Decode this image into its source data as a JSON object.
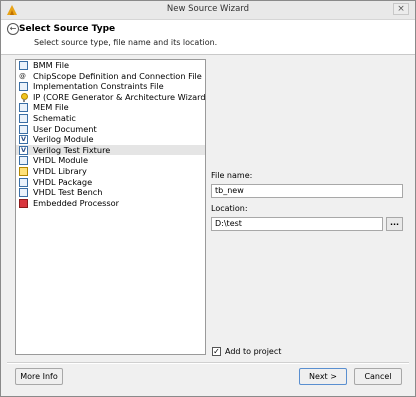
{
  "window": {
    "title": "New Source Wizard",
    "close_label": "×"
  },
  "header": {
    "title": "Select Source Type",
    "subtitle": "Select source type, file name and its location.",
    "back_label": "←"
  },
  "source_types": [
    {
      "label": "BMM File",
      "icon": "doc-icon",
      "selected": false
    },
    {
      "label": "ChipScope Definition and Connection File",
      "icon": "chipscope-icon",
      "selected": false
    },
    {
      "label": "Implementation Constraints File",
      "icon": "doc-icon",
      "selected": false
    },
    {
      "label": "IP (CORE Generator & Architecture Wizard)",
      "icon": "lightbulb-icon",
      "selected": false
    },
    {
      "label": "MEM File",
      "icon": "doc-icon",
      "selected": false
    },
    {
      "label": "Schematic",
      "icon": "doc-icon",
      "selected": false
    },
    {
      "label": "User Document",
      "icon": "doc-icon",
      "selected": false
    },
    {
      "label": "Verilog Module",
      "icon": "verilog-icon",
      "selected": false
    },
    {
      "label": "Verilog Test Fixture",
      "icon": "verilog-icon",
      "selected": true
    },
    {
      "label": "VHDL Module",
      "icon": "doc-icon",
      "selected": false
    },
    {
      "label": "VHDL Library",
      "icon": "library-icon",
      "selected": false
    },
    {
      "label": "VHDL Package",
      "icon": "doc-icon",
      "selected": false
    },
    {
      "label": "VHDL Test Bench",
      "icon": "doc-icon",
      "selected": false
    },
    {
      "label": "Embedded Processor",
      "icon": "processor-icon",
      "selected": false
    }
  ],
  "form": {
    "file_name_label": "File name:",
    "file_name_value": "tb_new",
    "location_label": "Location:",
    "location_value": "D:\\test",
    "browse_label": "...",
    "add_to_project_label": "Add to project",
    "add_to_project_checked": true,
    "check_mark": "✓"
  },
  "buttons": {
    "more_info": "More Info",
    "next": "Next >",
    "cancel": "Cancel"
  }
}
